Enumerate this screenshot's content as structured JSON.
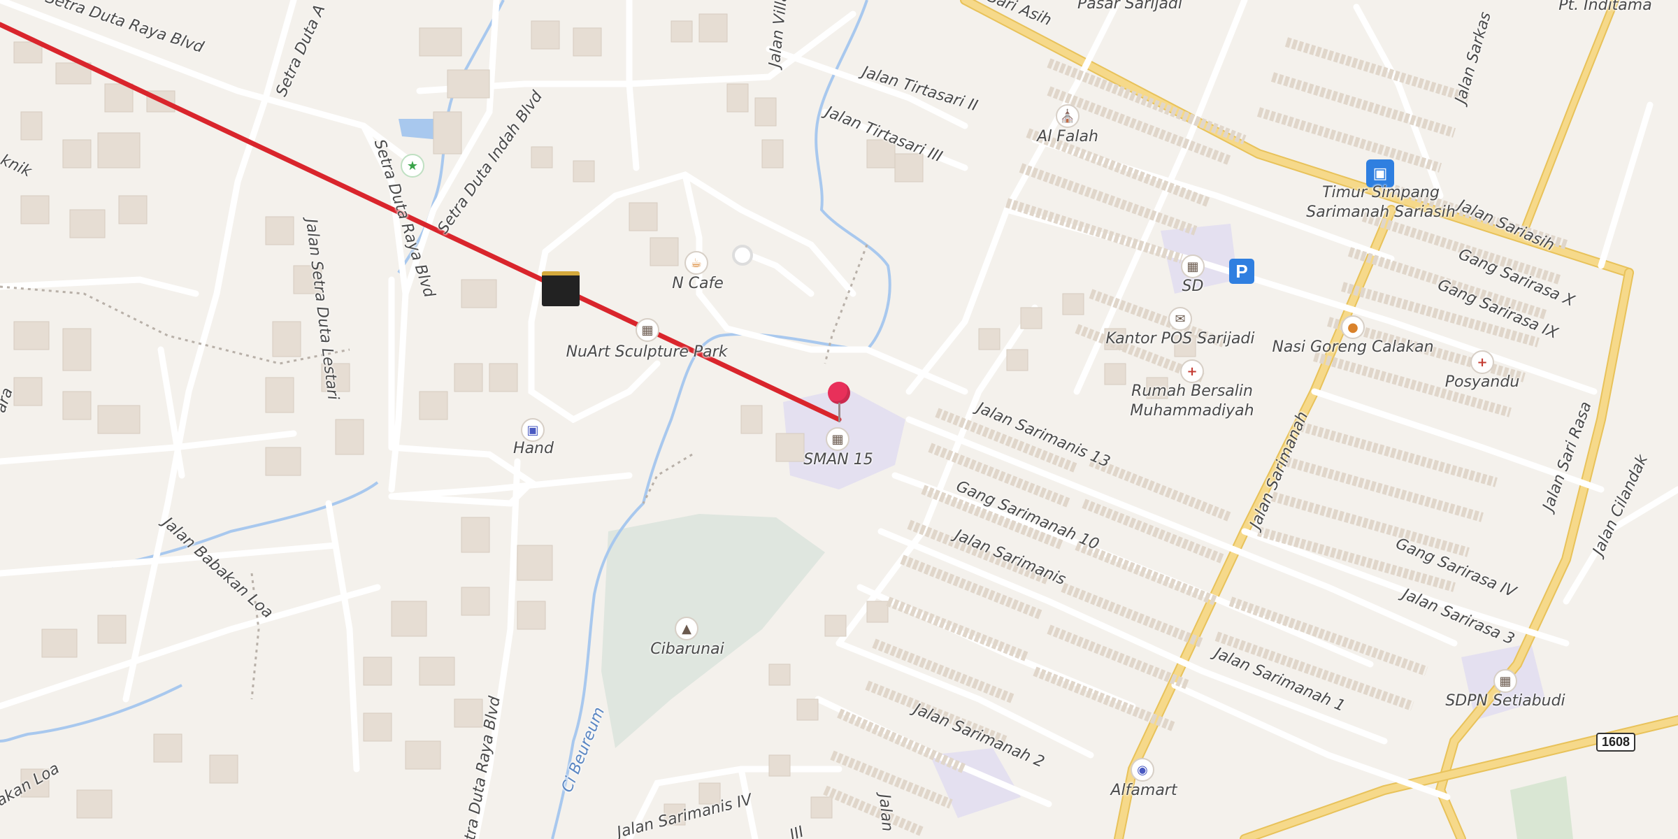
{
  "map": {
    "streets": {
      "setra_duta_raya_blvd_top": "Setra Duta Raya Blvd",
      "setra_duta_a": "Setra Duta A",
      "setra_duta_raya_blvd_right": "Setra Duta Raya Blvd",
      "setra_duta_indah_blvd": "Setra Duta Indah Blvd",
      "jalan_setra_duta_lestari": "Jalan Setra Duta Lestari",
      "jalan_babakan_loa": "Jalan Babakan Loa",
      "babakan_loa_bottom": "akan Loa",
      "setra_duta_raya_blvd_bottom": "Setra Duta Raya Blvd",
      "jalan_villa": "Jalan Villa",
      "jalan_tirtasari_ii": "Jalan Tirtasari II",
      "jalan_tirtasari_iii": "Jalan Tirtasari III",
      "ci_beureum": "Ci Beureum",
      "jalan_sariasih_top": "Sari Asih",
      "jalan_sariasih": "Jalan Sariasih",
      "gang_sarirasa_x": "Gang Sarirasa X",
      "gang_sarirasa_ix": "Gang Sarirasa IX",
      "gang_sarirasa_iv": "Gang Sarirasa IV",
      "jalan_sarirasa_3": "Jalan Sarirasa 3",
      "jalan_sarimanah": "Jalan Sarimanah",
      "jalan_sari_rasa": "Jalan Sari Rasa",
      "jalan_cilandak": "Jalan Cilandak",
      "jalan_sarkas": "Jalan Sarkas",
      "jalan_sarimanis_13": "Jalan Sarimanis 13",
      "gang_sarimanah_10": "Gang Sarimanah 10",
      "jalan_sarimanis": "Jalan Sarimanis",
      "jalan_sarimanah_1": "Jalan Sarimanah 1",
      "jalan_sarimanah_2": "Jalan Sarimanah 2",
      "jalan_sarimanis_iv": "Jalan Sarimanis IV",
      "jalan_bottom": "Jalan",
      "iii_bottom": "III",
      "knik": "knik",
      "ara": "ara"
    },
    "pois": {
      "pasar_sarijadi": "Pasar Sarijadi",
      "pt_inditama": "Pt. Inditama",
      "al_falah": "Al Falah",
      "timur_simpang": "Timur Simpang\nSarimanah Sariasih",
      "sd": "SD",
      "kantor_pos": "Kantor POS Sarijadi",
      "nasi_goreng": "Nasi Goreng Calakan",
      "posyandu": "Posyandu",
      "rumah_bersalin": "Rumah Bersalin\nMuhammadiyah",
      "n_cafe": "N Cafe",
      "nuart": "NuArt Sculpture Park",
      "hand": "Hand",
      "sman15": "SMAN 15",
      "cibarunai": "Cibarunai",
      "sdpn": "SDPN Setiabudi",
      "alfamart": "Alfamart"
    },
    "parking": "P",
    "route_shield": "1608",
    "colors": {
      "background": "#f4f1ec",
      "building": "#e6ddd3",
      "road": "#ffffff",
      "major_road": "#f3d27a",
      "water": "#a8c8ee",
      "route_line": "#e0262e",
      "pin": "#e8305a",
      "park": "#dfe6df",
      "school_area": "#e4e0f0"
    },
    "icons": {
      "mosque": "mosque-icon",
      "bus": "bus-stop-icon",
      "school": "school-icon",
      "mail": "post-office-icon",
      "food": "restaurant-icon",
      "medical": "medical-cross-icon",
      "cafe": "cafe-icon",
      "museum": "museum-icon",
      "gallery": "gallery-icon",
      "shop": "shopping-basket-icon",
      "playground": "playground-icon",
      "monument": "monument-icon",
      "kaaba": "kaaba-icon",
      "pin": "location-pin-icon",
      "parking": "parking-icon"
    }
  }
}
